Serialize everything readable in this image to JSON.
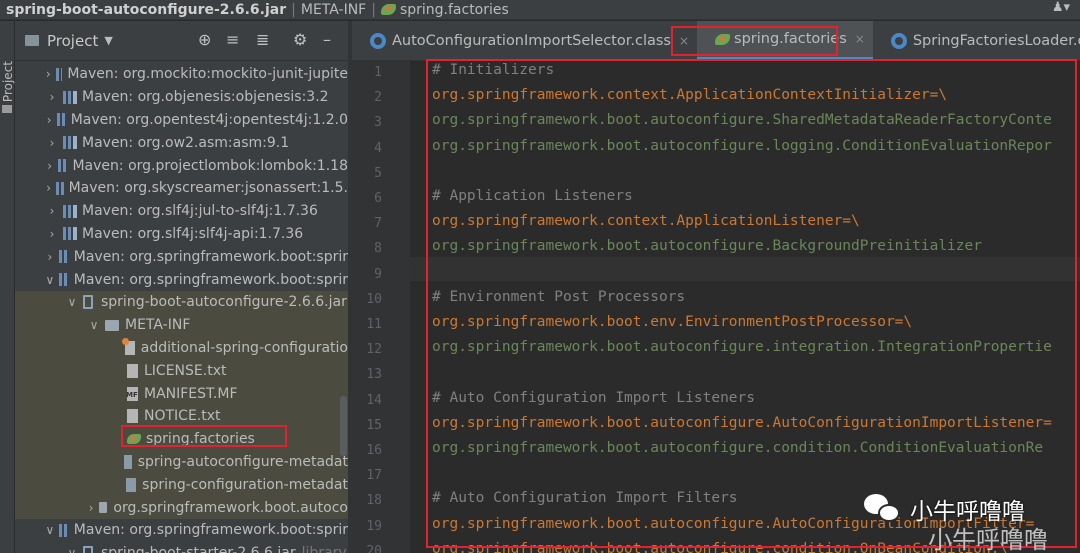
{
  "breadcrumb": {
    "items": [
      "spring-boot-autoconfigure-2.6.6.jar",
      "META-INF",
      "spring.factories"
    ]
  },
  "project": {
    "title": "Project",
    "tree": [
      {
        "label": "Maven: org.mockito:mockito-junit-jupite",
        "kind": "lib",
        "arrow": ">"
      },
      {
        "label": "Maven: org.objenesis:objenesis:3.2",
        "kind": "lib",
        "arrow": ">"
      },
      {
        "label": "Maven: org.opentest4j:opentest4j:1.2.0",
        "kind": "lib",
        "arrow": ">"
      },
      {
        "label": "Maven: org.ow2.asm:asm:9.1",
        "kind": "lib",
        "arrow": ">"
      },
      {
        "label": "Maven: org.projectlombok:lombok:1.18",
        "kind": "lib",
        "arrow": ">"
      },
      {
        "label": "Maven: org.skyscreamer:jsonassert:1.5.",
        "kind": "lib",
        "arrow": ">"
      },
      {
        "label": "Maven: org.slf4j:jul-to-slf4j:1.7.36",
        "kind": "lib",
        "arrow": ">"
      },
      {
        "label": "Maven: org.slf4j:slf4j-api:1.7.36",
        "kind": "lib",
        "arrow": ">"
      },
      {
        "label": "Maven: org.springframework.boot:sprir",
        "kind": "lib",
        "arrow": ">"
      },
      {
        "label": "Maven: org.springframework.boot:sprir",
        "kind": "lib",
        "arrow": "v"
      },
      {
        "label": "spring-boot-autoconfigure-2.6.6.jar",
        "kind": "jar",
        "arrow": "v"
      },
      {
        "label": "META-INF",
        "kind": "folder",
        "arrow": "v"
      },
      {
        "label": "additional-spring-configuratio",
        "kind": "gear",
        "arrow": ""
      },
      {
        "label": "LICENSE.txt",
        "kind": "file",
        "arrow": ""
      },
      {
        "label": "MANIFEST.MF",
        "kind": "mf",
        "arrow": ""
      },
      {
        "label": "NOTICE.txt",
        "kind": "file",
        "arrow": ""
      },
      {
        "label": "spring.factories",
        "kind": "leaf",
        "arrow": ""
      },
      {
        "label": "spring-autoconfigure-metadat",
        "kind": "js",
        "arrow": ""
      },
      {
        "label": "spring-configuration-metadat",
        "kind": "js",
        "arrow": ""
      },
      {
        "label": "org.springframework.boot.autoco",
        "kind": "folder",
        "arrow": ">"
      },
      {
        "label": "Maven: org.springframework.boot:sprir",
        "kind": "lib",
        "arrow": "v"
      },
      {
        "label": "spring-boot-starter-2.6.6.jar",
        "kind": "jar",
        "arrow": "v",
        "suffix": "library"
      }
    ]
  },
  "tabs": [
    {
      "label": "AutoConfigurationImportSelector.class",
      "icon": "class-icon",
      "close": "×"
    },
    {
      "label": "spring.factories",
      "icon": "spring-leaf-icon",
      "close": "×"
    },
    {
      "label": "SpringFactoriesLoader.class",
      "icon": "class-icon",
      "close": "×"
    }
  ],
  "editor": {
    "lines": [
      {
        "num": "1",
        "comment": "# Initializers",
        "key": "",
        "value": ""
      },
      {
        "num": "2",
        "comment": "",
        "key": "org.springframework.context.ApplicationContextInitializer=\\",
        "value": ""
      },
      {
        "num": "3",
        "comment": "",
        "key": "",
        "value": "org.springframework.boot.autoconfigure.SharedMetadataReaderFactoryConte"
      },
      {
        "num": "4",
        "comment": "",
        "key": "",
        "value": "org.springframework.boot.autoconfigure.logging.ConditionEvaluationRepor"
      },
      {
        "num": "5",
        "comment": "",
        "key": "",
        "value": ""
      },
      {
        "num": "6",
        "comment": "# Application Listeners",
        "key": "",
        "value": ""
      },
      {
        "num": "7",
        "comment": "",
        "key": "org.springframework.context.ApplicationListener=\\",
        "value": ""
      },
      {
        "num": "8",
        "comment": "",
        "key": "",
        "value": "org.springframework.boot.autoconfigure.BackgroundPreinitializer"
      },
      {
        "num": "9",
        "comment": "",
        "key": "",
        "value": ""
      },
      {
        "num": "10",
        "comment": "# Environment Post Processors",
        "key": "",
        "value": ""
      },
      {
        "num": "11",
        "comment": "",
        "key": "org.springframework.boot.env.EnvironmentPostProcessor=\\",
        "value": ""
      },
      {
        "num": "12",
        "comment": "",
        "key": "",
        "value": "org.springframework.boot.autoconfigure.integration.IntegrationPropertie"
      },
      {
        "num": "13",
        "comment": "",
        "key": "",
        "value": ""
      },
      {
        "num": "14",
        "comment": "# Auto Configuration Import Listeners",
        "key": "",
        "value": ""
      },
      {
        "num": "15",
        "comment": "",
        "key": "org.springframework.boot.autoconfigure.AutoConfigurationImportListener=",
        "value": ""
      },
      {
        "num": "16",
        "comment": "",
        "key": "",
        "value": "org.springframework.boot.autoconfigure.condition.ConditionEvaluationRe"
      },
      {
        "num": "17",
        "comment": "",
        "key": "",
        "value": ""
      },
      {
        "num": "18",
        "comment": "# Auto Configuration Import Filters",
        "key": "",
        "value": ""
      },
      {
        "num": "19",
        "comment": "",
        "key": "org.springframework.boot.autoconfigure.AutoConfigurationImportFilter=",
        "value": ""
      },
      {
        "num": "20",
        "comment": "",
        "key": "org.springframework.boot.autoconfigure.condition.OnBeanCondition,\\",
        "value": ""
      }
    ]
  },
  "watermark": {
    "text": "小牛呼噜噜",
    "handwritten": "小牛呼噜噜"
  },
  "colors": {
    "highlight_box": "#e0232e",
    "keyword": "#cc7832",
    "string": "#6a8759",
    "comment": "#808080"
  }
}
